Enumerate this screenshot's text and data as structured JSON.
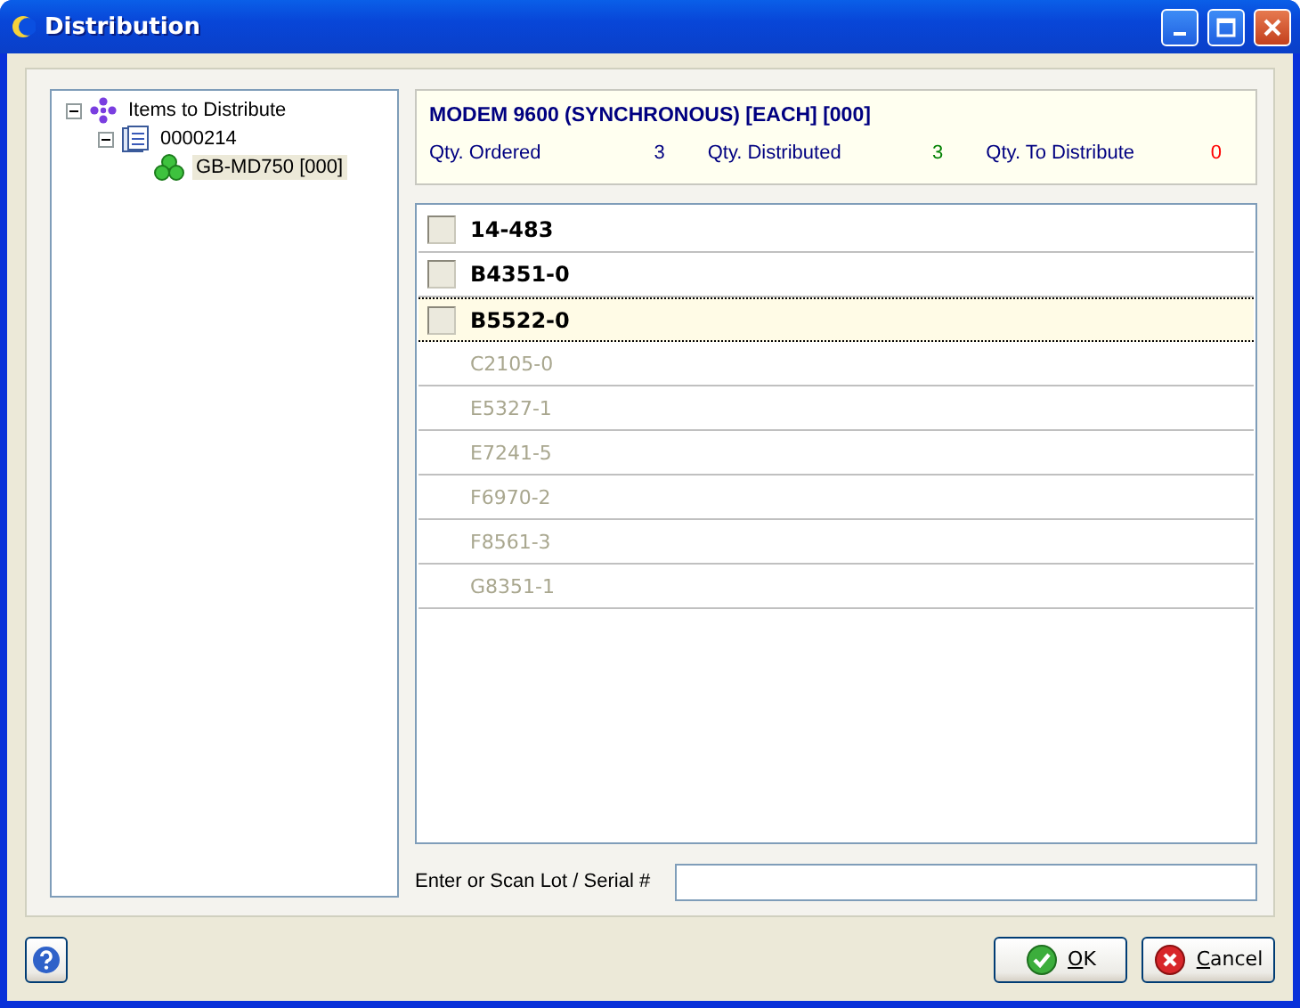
{
  "window": {
    "title": "Distribution"
  },
  "tree": [
    {
      "label": "Items to Distribute",
      "kind": "root",
      "expanded": true,
      "selected": false,
      "children": [
        {
          "label": "0000214",
          "kind": "order",
          "expanded": true,
          "selected": false,
          "children": [
            {
              "label": "GB-MD750 [000]",
              "kind": "item",
              "selected": true
            }
          ]
        }
      ]
    }
  ],
  "item": {
    "title": "MODEM 9600 (SYNCHRONOUS) [EACH] [000]",
    "quantities": [
      {
        "label": "Qty. Ordered",
        "value": "3",
        "color": "#000080"
      },
      {
        "label": "Qty. Distributed",
        "value": "3",
        "color": "#008000"
      },
      {
        "label": "Qty. To Distribute",
        "value": "0",
        "color": "#ff0000"
      }
    ]
  },
  "lots": [
    {
      "label": "14-483",
      "enabled": true,
      "checked": false,
      "selected": false
    },
    {
      "label": "B4351-0",
      "enabled": true,
      "checked": false,
      "selected": false
    },
    {
      "label": "B5522-0",
      "enabled": true,
      "checked": false,
      "selected": true
    },
    {
      "label": "C2105-0",
      "enabled": false,
      "selected": false
    },
    {
      "label": "E5327-1",
      "enabled": false,
      "selected": false
    },
    {
      "label": "E7241-5",
      "enabled": false,
      "selected": false
    },
    {
      "label": "F6970-2",
      "enabled": false,
      "selected": false
    },
    {
      "label": "F8561-3",
      "enabled": false,
      "selected": false
    },
    {
      "label": "G8351-1",
      "enabled": false,
      "selected": false
    }
  ],
  "scan": {
    "label": "Enter or Scan Lot / Serial #"
  },
  "buttons": [
    {
      "label": "OK",
      "kind": "ok"
    },
    {
      "label": "Cancel",
      "kind": "cancel"
    }
  ]
}
